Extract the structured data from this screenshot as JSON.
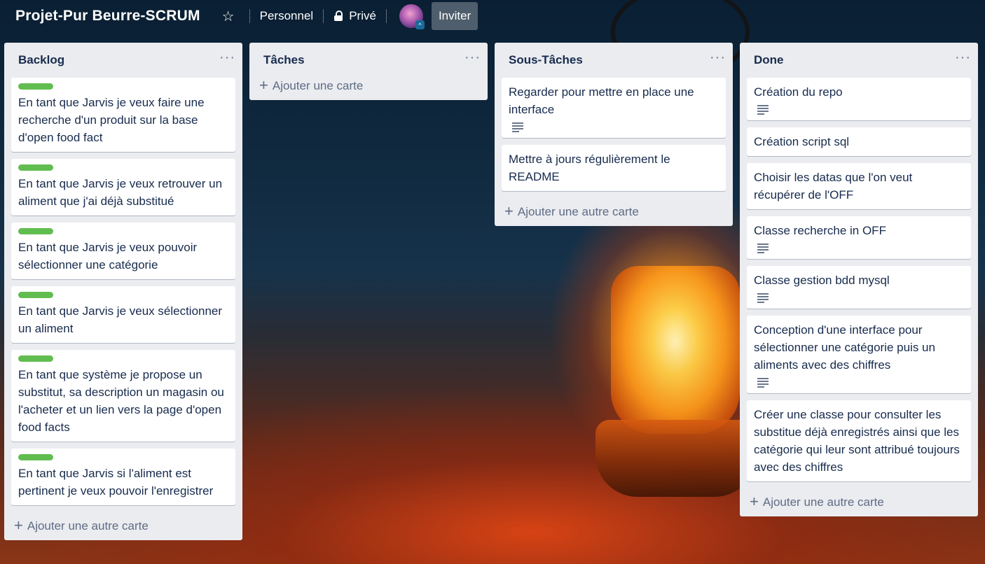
{
  "header": {
    "board_title": "Projet-Pur Beurre-SCRUM",
    "star_icon": "star-icon",
    "workspace_label": "Personnel",
    "visibility_label": "Privé",
    "invite_label": "Inviter"
  },
  "lists": [
    {
      "title": "Backlog",
      "cards": [
        {
          "text": "En tant que Jarvis je veux faire une recherche d'un produit sur la base d'open food fact",
          "label_color": "#61bd4f"
        },
        {
          "text": "En tant que Jarvis je veux retrouver un aliment que j'ai déjà substitué",
          "label_color": "#61bd4f"
        },
        {
          "text": "En tant que Jarvis je veux pouvoir sélectionner une catégorie",
          "label_color": "#61bd4f"
        },
        {
          "text": "En tant que Jarvis je veux sélectionner un aliment",
          "label_color": "#61bd4f"
        },
        {
          "text": "En tant que système je propose un substitut, sa description un magasin ou l'acheter et un lien vers la page d'open food facts",
          "label_color": "#61bd4f"
        },
        {
          "text": "En tant que Jarvis si l'aliment est pertinent je veux pouvoir l'enregistrer",
          "label_color": "#61bd4f"
        }
      ],
      "add_label": "Ajouter une autre carte"
    },
    {
      "title": "Tâches",
      "cards": [],
      "add_label": "Ajouter une carte"
    },
    {
      "title": "Sous-Tâches",
      "cards": [
        {
          "text": "Regarder pour mettre en place une interface",
          "has_description": true
        },
        {
          "text": "Mettre à jours régulièrement le README",
          "has_description": false
        }
      ],
      "add_label": "Ajouter une autre carte"
    },
    {
      "title": "Done",
      "cards": [
        {
          "text": "Création du repo",
          "has_description": true
        },
        {
          "text": "Création script sql",
          "has_description": false
        },
        {
          "text": "Choisir les datas que l'on veut récupérer de l'OFF",
          "has_description": false
        },
        {
          "text": "Classe recherche in OFF",
          "has_description": true
        },
        {
          "text": "Classe gestion bdd mysql",
          "has_description": true
        },
        {
          "text": "Conception d'une interface pour sélectionner une catégorie puis un aliments avec des chiffres",
          "has_description": true
        },
        {
          "text": "Créer une classe pour consulter les substitue déjà enregistrés ainsi que les catégorie qui leur sont attribué toujours avec des chiffres",
          "has_description": false
        }
      ],
      "add_label": "Ajouter une autre carte"
    }
  ],
  "menu_glyph": "···",
  "add_glyph": "+"
}
